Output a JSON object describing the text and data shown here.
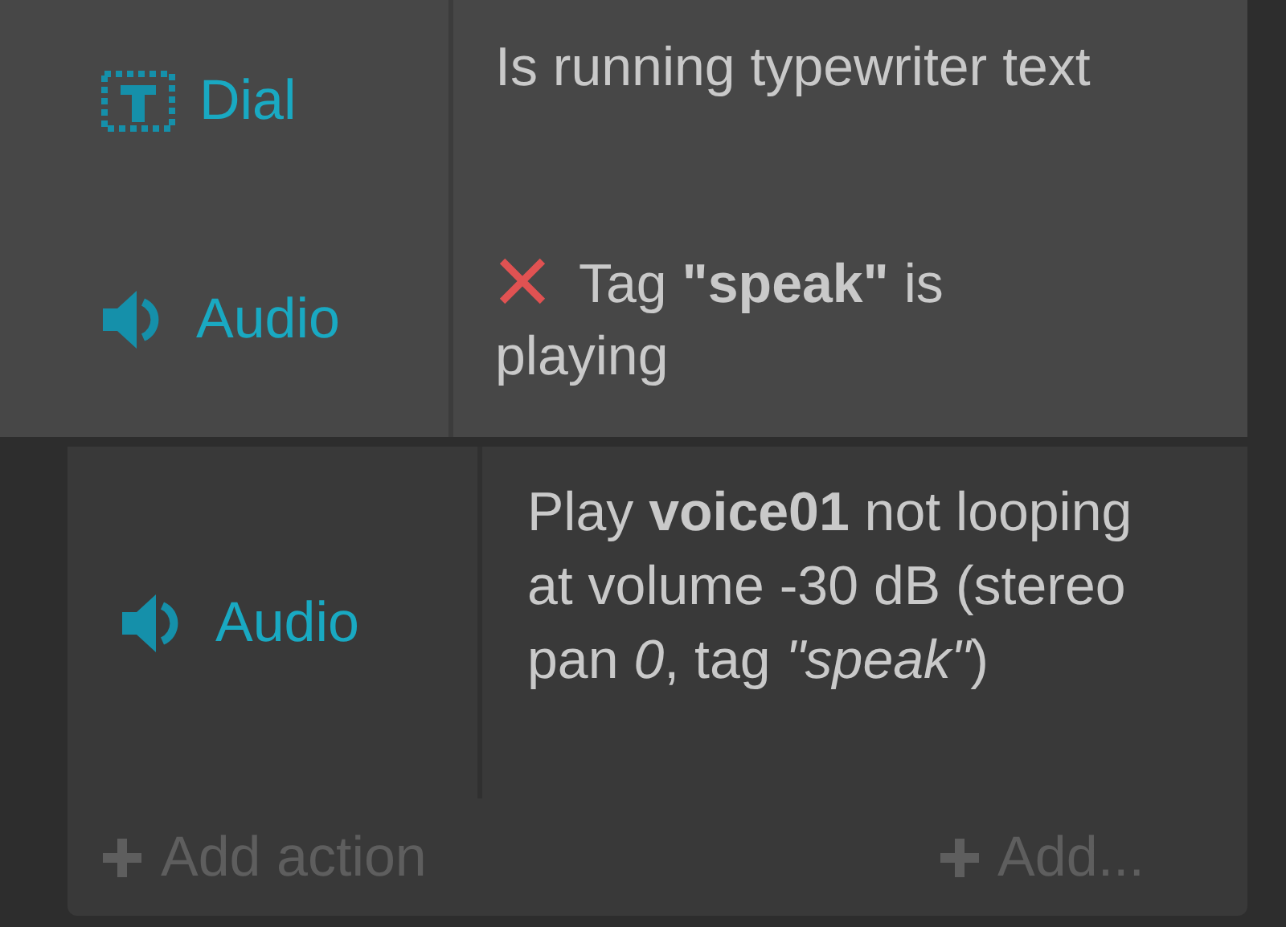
{
  "conditions": [
    {
      "object": "Dial",
      "kind": "text",
      "inverted": false,
      "text": "Is running typewriter text"
    },
    {
      "object": "Audio",
      "kind": "audio",
      "inverted": true,
      "text": "Tag **\"speak\"** is playing"
    }
  ],
  "actions": [
    {
      "object": "Audio",
      "kind": "audio",
      "text": "Play **voice01** not looping at volume -30 dB (stereo pan *0*, tag *\"speak\"*)"
    }
  ],
  "add_action": "Add action",
  "add_other": "Add..."
}
